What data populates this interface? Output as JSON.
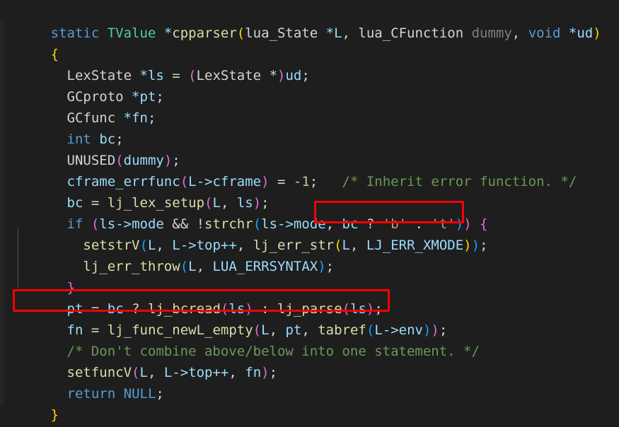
{
  "editor": {
    "background_color": "#1e1e1e",
    "default_text_color": "#d4d4d4",
    "language": "C",
    "font_size_px": 19,
    "line_height_px": 30
  },
  "palette": {
    "keyword": "#569cd6",
    "type": "#4ec9b0",
    "function": "#dcdcaa",
    "variable": "#9cdcfe",
    "comment": "#6a9955",
    "string": "#ce9178",
    "number": "#b5cea8",
    "dimmed": "#808080",
    "bracket_level_1": "#ffd700",
    "bracket_level_2": "#da70d6",
    "bracket_level_3": "#179fff",
    "annotation_box": "#ff0000",
    "indent_guide": "#555555"
  },
  "code": {
    "line_01": {
      "t01": "static",
      "t02": " ",
      "t03": "TValue",
      "t04": " *",
      "t05": "cpparser",
      "t06": "(",
      "t07": "lua_State",
      "t08": " *",
      "t09": "L",
      "t10": ", ",
      "t11": "lua_CFunction",
      "t12": " ",
      "t13": "dummy",
      "t14": ", ",
      "t15": "void",
      "t16": " *",
      "t17": "ud",
      "t18": ")"
    },
    "line_02": {
      "t01": "{"
    },
    "line_03": {
      "t01": "  ",
      "t02": "LexState",
      "t03": " *",
      "t04": "ls",
      "t05": " = ",
      "t06": "(",
      "t07": "LexState",
      "t08": " *",
      "t09": ")",
      "t10": "ud",
      "t11": ";"
    },
    "line_04": {
      "t01": "  ",
      "t02": "GCproto",
      "t03": " *",
      "t04": "pt",
      "t05": ";"
    },
    "line_05": {
      "t01": "  ",
      "t02": "GCfunc",
      "t03": " *",
      "t04": "fn",
      "t05": ";"
    },
    "line_06": {
      "t01": "  ",
      "t02": "int",
      "t03": " ",
      "t04": "bc",
      "t05": ";"
    },
    "line_07": {
      "t01": "  ",
      "t02": "UNUSED",
      "t03": "(",
      "t04": "dummy",
      "t05": ")",
      "t06": ";"
    },
    "line_08": {
      "t01": "  ",
      "t02": "cframe_errfunc",
      "t03": "(",
      "t04": "L->cframe",
      "t05": ")",
      "t06": " = ",
      "t07": "-1",
      "t08": ";",
      "t09": "   ",
      "t10": "/* Inherit error function. */"
    },
    "line_09": {
      "t01": "  ",
      "t02": "bc",
      "t03": " = ",
      "t04": "lj_lex_setup",
      "t05": "(",
      "t06": "L",
      "t07": ", ",
      "t08": "ls",
      "t09": ")",
      "t10": ";"
    },
    "line_10": {
      "t01": "  ",
      "t02": "if",
      "t03": " ",
      "t04": "(",
      "t05": "ls->mode",
      "t06": " && !",
      "t07": "strchr",
      "t08": "(",
      "t09": "ls->mode",
      "t10": ", ",
      "t11": "bc",
      "t12": " ? ",
      "t13": "'b'",
      "t14": " : ",
      "t15": "'t'",
      "t16": ")",
      "t17": ")",
      "t18": " {"
    },
    "line_11": {
      "t01": "    ",
      "t02": "setstrV",
      "t03": "(",
      "t04": "L",
      "t05": ", ",
      "t06": "L->top++",
      "t07": ", ",
      "t08": "lj_err_str",
      "t09": "(",
      "t10": "L",
      "t11": ", ",
      "t12": "LJ_ERR_XMODE",
      "t13": ")",
      "t14": ")",
      "t15": ";"
    },
    "line_12": {
      "t01": "    ",
      "t02": "lj_err_throw",
      "t03": "(",
      "t04": "L",
      "t05": ", ",
      "t06": "LUA_ERRSYNTAX",
      "t07": ")",
      "t08": ";"
    },
    "line_13": {
      "t01": "  ",
      "t02": "}"
    },
    "line_14": {
      "t01": "  ",
      "t02": "pt",
      "t03": " = ",
      "t04": "bc",
      "t05": " ? ",
      "t06": "lj_bcread",
      "t07": "(",
      "t08": "ls",
      "t09": ")",
      "t10": " : ",
      "t11": "lj_parse",
      "t12": "(",
      "t13": "ls",
      "t14": ")",
      "t15": ";"
    },
    "line_15": {
      "t01": "  ",
      "t02": "fn",
      "t03": " = ",
      "t04": "lj_func_newL_empty",
      "t05": "(",
      "t06": "L",
      "t07": ", ",
      "t08": "pt",
      "t09": ", ",
      "t10": "tabref",
      "t11": "(",
      "t12": "L->env",
      "t13": ")",
      "t14": ")",
      "t15": ";"
    },
    "line_16": {
      "t01": "  ",
      "t02": "/* Don't combine above/below into one statement. */"
    },
    "line_17": {
      "t01": "  ",
      "t02": "setfuncV",
      "t03": "(",
      "t04": "L",
      "t05": ", ",
      "t06": "L->top++",
      "t07": ", ",
      "t08": "fn",
      "t09": ")",
      "t10": ";"
    },
    "line_18": {
      "t01": "  ",
      "t02": "return",
      "t03": " ",
      "t04": "NULL",
      "t05": ";"
    },
    "line_19": {
      "t01": "}"
    }
  },
  "annotations": [
    {
      "id": "annot-1",
      "label": "highlight-ternary-mode-char",
      "color": "#ff0000",
      "target_text": "bc ? 'b' : 't'))"
    },
    {
      "id": "annot-2",
      "label": "highlight-ternary-parse-dispatch",
      "color": "#ff0000",
      "target_text": "pt = bc ? lj_bcread(ls) : lj_parse(ls);"
    }
  ]
}
